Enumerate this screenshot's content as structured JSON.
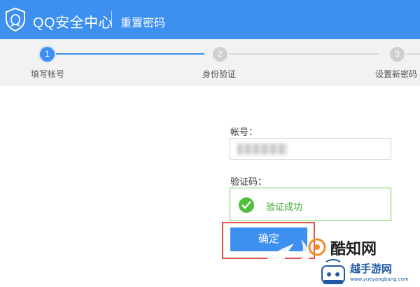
{
  "header": {
    "brand": "QQ安全中心",
    "subtitle": "重置密码",
    "background_color": "#3d8ff0"
  },
  "steps": [
    {
      "number": "1",
      "label": "填写帐号",
      "state": "active"
    },
    {
      "number": "2",
      "label": "身份验证",
      "state": "inactive"
    },
    {
      "number": "3",
      "label": "设置新密码",
      "state": "inactive"
    }
  ],
  "form": {
    "account_label": "帐号：",
    "captcha_label": "验证码：",
    "verify_status": "验证成功",
    "confirm_label": "确定"
  },
  "watermarks": {
    "brand1": "酷知网",
    "brand2": "越手游网",
    "brand2_url": "www.yueyangbang.com"
  },
  "colors": {
    "accent": "#3d8ff0",
    "success": "#4fbe3c",
    "highlight_frame": "#e2534c"
  }
}
